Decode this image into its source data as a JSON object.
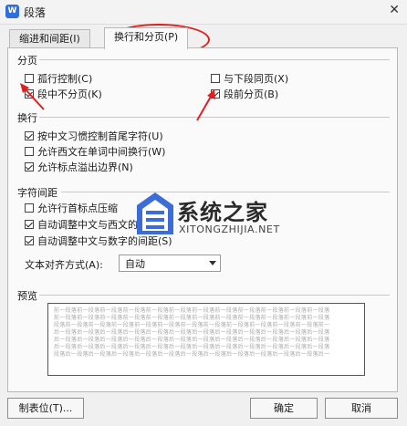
{
  "window": {
    "title": "段落",
    "app_icon_letter": "W",
    "close_glyph": "✕"
  },
  "tabs": [
    {
      "label": "缩进和间距(I)",
      "active": false
    },
    {
      "label": "换行和分页(P)",
      "active": true
    }
  ],
  "pagination": {
    "heading": "分页",
    "options": [
      {
        "label": "孤行控制(C)",
        "checked": false
      },
      {
        "label": "与下段同页(X)",
        "checked": false
      },
      {
        "label": "段中不分页(K)",
        "checked": true
      },
      {
        "label": "段前分页(B)",
        "checked": true
      }
    ]
  },
  "line_break": {
    "heading": "换行",
    "options": [
      {
        "label": "按中文习惯控制首尾字符(U)",
        "checked": true
      },
      {
        "label": "允许西文在单词中间换行(W)",
        "checked": false
      },
      {
        "label": "允许标点溢出边界(N)",
        "checked": true
      }
    ]
  },
  "char_spacing": {
    "heading": "字符间距",
    "options": [
      {
        "label": "允许行首标点压缩",
        "checked": false
      },
      {
        "label": "自动调整中文与西文的间距",
        "checked": true
      },
      {
        "label": "自动调整中文与数字的间距(S)",
        "checked": true
      }
    ],
    "align_label": "文本对齐方式(A):",
    "align_value": "自动"
  },
  "preview": {
    "heading": "预览",
    "lines": [
      "前一段落前一段落前一段落前一段落前一段落前一段落前一段落前一段落前一段落前一段落前一段落前一段落",
      "前一段落前一段落前一段落前一段落前一段落前一段落前一段落前一段落前一段落前一段落前一段落前一段落",
      "段落前一段落前一段落前一段落前一段落前一段落前一段落前一段落前一段落前一段落前一段落前一段落前一",
      "后一段落后一段落后一段落后一段落后一段落后一段落后一段落后一段落后一段落后一段落后一段落后一段落",
      "后一段落后一段落后一段落后一段落后一段落后一段落后一段落后一段落后一段落后一段落后一段落后一段落",
      "后一段落后一段落后一段落后一段落后一段落后一段落后一段落后一段落后一段落后一段落后一段落后一段落",
      "段落后一段落后一段落后一段落后一段落后一段落后一段落后一段落后一段落后一段落后一段落后一段落后一"
    ]
  },
  "buttons": {
    "tabs": "制表位(T)...",
    "ok": "确定",
    "cancel": "取消"
  },
  "watermark": {
    "brand": "系统之家",
    "site": "XITONGZHIJIA.NET"
  },
  "colors": {
    "annotation": "#e02020",
    "accent": "#2d6fdc"
  }
}
